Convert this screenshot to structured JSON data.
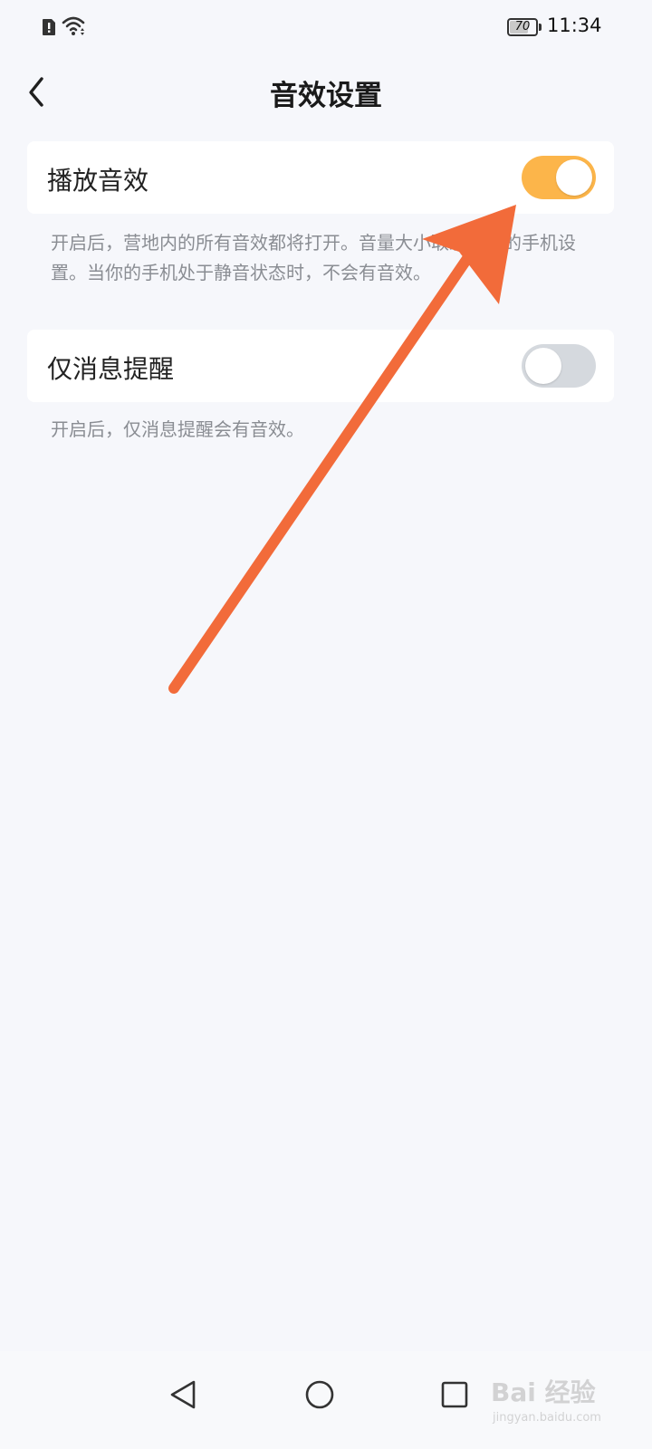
{
  "status_bar": {
    "icons": [
      "alert-icon",
      "wifi-icon",
      "battery-icon"
    ],
    "battery_level": "70",
    "battery_fraction": 0.7,
    "time": "11:34"
  },
  "header": {
    "back_icon": "chevron-left-icon",
    "title": "音效设置"
  },
  "settings": [
    {
      "label": "播放音效",
      "enabled": true,
      "description": "开启后，营地内的所有音效都将打开。音量大小取决于你的手机设置。当你的手机处于静音状态时，不会有音效。"
    },
    {
      "label": "仅消息提醒",
      "enabled": false,
      "description": "开启后，仅消息提醒会有音效。"
    }
  ],
  "colors": {
    "toggle_on": "#fcb54a",
    "toggle_off": "#d5d9de",
    "annotation_arrow": "#f26b3a",
    "background": "#f6f7fb"
  },
  "nav_bar": {
    "icons": [
      "back-triangle-icon",
      "home-circle-icon",
      "recents-square-icon"
    ]
  },
  "watermark": {
    "text": "Bai 经验",
    "url": "jingyan.baidu.com"
  }
}
